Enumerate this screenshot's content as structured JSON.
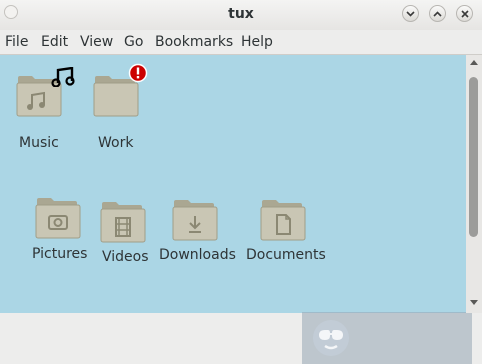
{
  "window": {
    "title": "tux"
  },
  "menu": {
    "items": [
      "File",
      "Edit",
      "View",
      "Go",
      "Bookmarks",
      "Help"
    ]
  },
  "files": [
    {
      "name": "Music",
      "icon": "folder-music-icon",
      "emblem": "music-note-icon"
    },
    {
      "name": "Work",
      "icon": "folder-icon",
      "emblem": "important-emblem-icon"
    },
    {
      "name": "Pictures",
      "icon": "folder-pictures-icon"
    },
    {
      "name": "Videos",
      "icon": "folder-videos-icon"
    },
    {
      "name": "Downloads",
      "icon": "folder-downloads-icon"
    },
    {
      "name": "Documents",
      "icon": "folder-documents-icon"
    }
  ],
  "colors": {
    "background": "#abd6e5",
    "folder": "#c9c6b4",
    "emblem_red": "#cc0000"
  }
}
